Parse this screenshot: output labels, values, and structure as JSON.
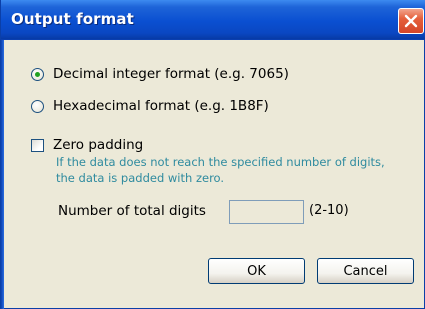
{
  "window": {
    "title": "Output format",
    "close_icon": "close-x-icon",
    "accent_color": "#0a4fd1"
  },
  "format_options": [
    {
      "label": "Decimal integer format (e.g. 7065)",
      "selected": true
    },
    {
      "label": "Hexadecimal format (e.g. 1B8F)",
      "selected": false
    }
  ],
  "zero_padding": {
    "label": "Zero padding",
    "checked": false,
    "hint_line1": "If the data does not reach the specified number of digits,",
    "hint_line2": "the data is padded with zero.",
    "hint_color": "#2f8b9f"
  },
  "digits": {
    "label": "Number of total digits",
    "value": "",
    "range": "(2-10)"
  },
  "buttons": {
    "ok": "OK",
    "cancel": "Cancel"
  }
}
